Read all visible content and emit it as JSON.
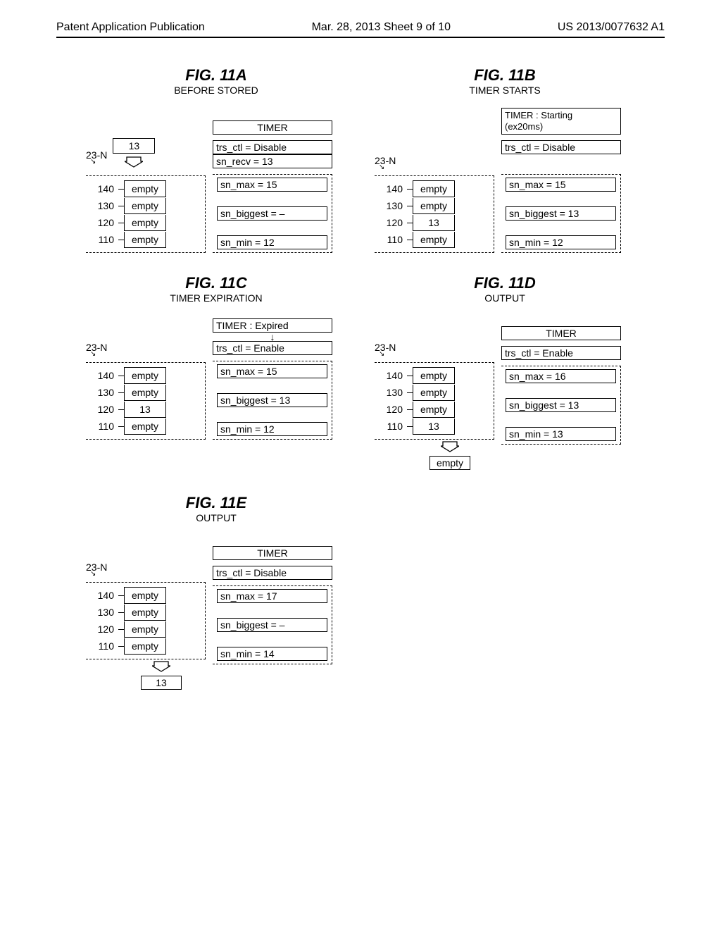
{
  "header": {
    "left": "Patent Application Publication",
    "mid": "Mar. 28, 2013  Sheet 9 of 10",
    "right": "US 2013/0077632 A1"
  },
  "figs": {
    "a": {
      "title": "FIG. 11A",
      "sub": "BEFORE STORED",
      "timer": "TIMER",
      "trs": "trs_ctl = Disable",
      "recv": "sn_recv = 13",
      "in_packet": "13",
      "label": "23-N",
      "slots": {
        "140": "empty",
        "130": "empty",
        "120": "empty",
        "110": "empty"
      },
      "r1": "sn_max = 15",
      "r2": "sn_biggest = –",
      "r3": "sn_min = 12"
    },
    "b": {
      "title": "FIG. 11B",
      "sub": "TIMER STARTS",
      "timer": "TIMER : Starting\n(ex20ms)",
      "trs": "trs_ctl = Disable",
      "label": "23-N",
      "slots": {
        "140": "empty",
        "130": "empty",
        "120": "13",
        "110": "empty"
      },
      "r1": "sn_max = 15",
      "r2": "sn_biggest = 13",
      "r3": "sn_min = 12"
    },
    "c": {
      "title": "FIG. 11C",
      "sub": "TIMER EXPIRATION",
      "timer": "TIMER : Expired",
      "trs": "trs_ctl = Enable",
      "label": "23-N",
      "slots": {
        "140": "empty",
        "130": "empty",
        "120": "13",
        "110": "empty"
      },
      "r1": "sn_max = 15",
      "r2": "sn_biggest = 13",
      "r3": "sn_min = 12"
    },
    "d": {
      "title": "FIG. 11D",
      "sub": "OUTPUT",
      "timer": "TIMER",
      "trs": "trs_ctl = Enable",
      "label": "23-N",
      "slots": {
        "140": "empty",
        "130": "empty",
        "120": "empty",
        "110": "13"
      },
      "r1": "sn_max = 16",
      "r2": "sn_biggest = 13",
      "r3": "sn_min = 13",
      "out": "empty"
    },
    "e": {
      "title": "FIG. 11E",
      "sub": "OUTPUT",
      "timer": "TIMER",
      "trs": "trs_ctl = Disable",
      "label": "23-N",
      "slots": {
        "140": "empty",
        "130": "empty",
        "120": "empty",
        "110": "empty"
      },
      "r1": "sn_max = 17",
      "r2": "sn_biggest = –",
      "r3": "sn_min = 14",
      "out": "13"
    }
  },
  "addr": {
    "a": "140",
    "b": "130",
    "c": "120",
    "d": "110"
  }
}
